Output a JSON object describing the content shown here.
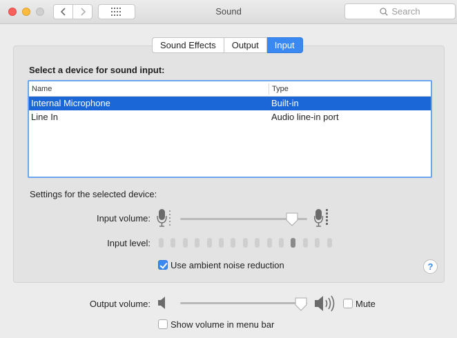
{
  "window": {
    "title": "Sound"
  },
  "toolbar": {
    "search_placeholder": "Search"
  },
  "tabs": [
    {
      "label": "Sound Effects",
      "active": false
    },
    {
      "label": "Output",
      "active": false
    },
    {
      "label": "Input",
      "active": true
    }
  ],
  "input": {
    "section_title": "Select a device for sound input:",
    "columns": {
      "name": "Name",
      "type": "Type"
    },
    "devices": [
      {
        "name": "Internal Microphone",
        "type": "Built-in",
        "selected": true
      },
      {
        "name": "Line In",
        "type": "Audio line-in port",
        "selected": false
      }
    ],
    "settings_label": "Settings for the selected device:",
    "input_volume_label": "Input volume:",
    "input_volume_fraction": 0.88,
    "input_level_label": "Input level:",
    "input_level_segments_total": 15,
    "input_level_active_segment": 12,
    "noise_reduction_label": "Use ambient noise reduction",
    "noise_reduction_checked": true,
    "help_label": "?"
  },
  "output": {
    "volume_label": "Output volume:",
    "volume_fraction": 0.95,
    "mute_label": "Mute",
    "mute_checked": false,
    "show_in_menu_bar_label": "Show volume in menu bar",
    "show_in_menu_bar_checked": false
  },
  "colors": {
    "accent": "#3a89f2",
    "selection": "#1b67d8",
    "close": "#fc605c",
    "minimize": "#fdbc40"
  },
  "icons": {
    "back": "chevron-left-icon",
    "forward": "chevron-right-icon",
    "show_all": "grid-icon",
    "search": "search-icon",
    "mic_low": "microphone-low-icon",
    "mic_high": "microphone-high-icon",
    "speaker_low": "speaker-low-icon",
    "speaker_high": "speaker-high-icon"
  }
}
